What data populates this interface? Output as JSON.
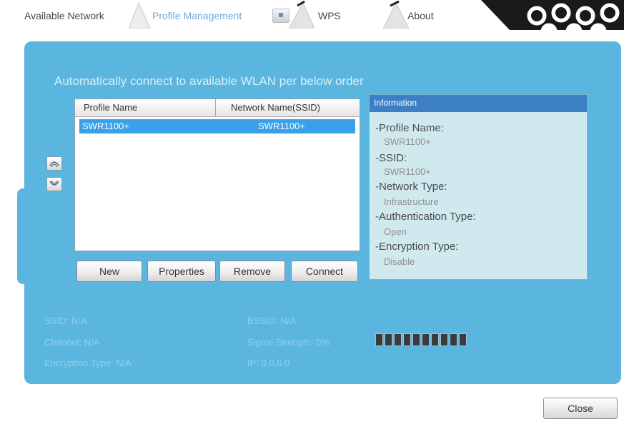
{
  "tabs": {
    "available_network": "Available Network",
    "profile_management": "Profile Management",
    "wps": "WPS",
    "about": "About",
    "active": "Profile Management"
  },
  "main": {
    "heading": "Automatically connect to available WLAN per below order",
    "list": {
      "columns": [
        "Profile Name",
        "Network Name(SSID)"
      ],
      "rows": [
        {
          "profile": "SWR1100+",
          "ssid": "SWR1100+",
          "selected": true
        }
      ]
    },
    "buttons": {
      "new": "New",
      "properties": "Properties",
      "remove": "Remove",
      "connect": "Connect"
    }
  },
  "info": {
    "title": "Information",
    "profile_name_label": "-Profile Name:",
    "profile_name": "SWR1100+",
    "ssid_label": "-SSID:",
    "ssid": "SWR1100+",
    "network_type_label": "-Network Type:",
    "network_type": "Infrastructure",
    "auth_type_label": "-Authentication Type:",
    "auth_type": "Open",
    "encryption_type_label": "-Encryption Type:",
    "encryption_type": "Disable"
  },
  "status": {
    "ssid": "SSID: N/A",
    "channel": "Channel: N/A",
    "encryption": "Encryption Type: N/A",
    "bssid": "BSSID: N/A",
    "signal": "Signal Strength: 0%",
    "ip": "IP: 0.0.0.0",
    "signal_strength_percent": 0,
    "signal_segments": 10
  },
  "footer": {
    "close": "Close"
  },
  "colors": {
    "panel": "#5ab6de",
    "selection": "#3aa0ea",
    "info_title": "#3d7fc4",
    "info_bg": "#cfe9ef"
  },
  "icons": {
    "move_up": "move-up-icon",
    "move_down": "move-down-icon",
    "wps": "wps-icon"
  }
}
